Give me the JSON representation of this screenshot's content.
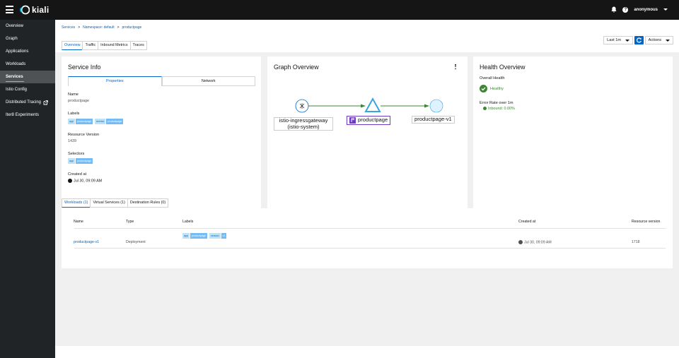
{
  "topbar": {
    "brand": "kiali",
    "user": "anonymous"
  },
  "sidebar": {
    "items": [
      {
        "label": "Overview",
        "active": false
      },
      {
        "label": "Graph",
        "active": false
      },
      {
        "label": "Applications",
        "active": false
      },
      {
        "label": "Workloads",
        "active": false
      },
      {
        "label": "Services",
        "active": true
      },
      {
        "label": "Istio Config",
        "active": false
      },
      {
        "label": "Distributed Tracing",
        "active": false,
        "external": true
      },
      {
        "label": "Iter8 Experiments",
        "active": false
      }
    ]
  },
  "breadcrumb": {
    "items": [
      "Services",
      "Namespace: default",
      "productpage"
    ],
    "separator": ">"
  },
  "tabs": [
    "Overview",
    "Traffic",
    "Inbound Metrics",
    "Traces"
  ],
  "toolbar": {
    "range": "Last 1m",
    "actions": "Actions"
  },
  "service_info": {
    "title": "Service Info",
    "tabs": [
      "Properties",
      "Network"
    ],
    "name_label": "Name",
    "name_value": "productpage",
    "labels_label": "Labels",
    "labels": [
      {
        "key": "app",
        "value": "productpage"
      },
      {
        "key": "service",
        "value": "productpage"
      }
    ],
    "resource_version_label": "Resource Version",
    "resource_version_value": "1439",
    "selectors_label": "Selectors",
    "selectors": [
      {
        "key": "app",
        "value": "productpage"
      }
    ],
    "created_label": "Created at",
    "created_value": "Jul 30, 09:09 AM"
  },
  "graph": {
    "title": "Graph Overview",
    "nodes": [
      "istio-ingressgateway\n(istio-system)",
      "productpage",
      "productpage-v1"
    ],
    "node_lines": {
      "gateway_1": "istio-ingressgateway",
      "gateway_2": "(istio-system)",
      "service": "productpage",
      "version": "productpage-v1"
    }
  },
  "health": {
    "title": "Health Overview",
    "overall_label": "Overall Health",
    "overall_value": "Healthy",
    "error_rate_label": "Error Rate over 1m",
    "inbound_value": "Inbound: 0.00%"
  },
  "bottom_tabs": [
    "Workloads (1)",
    "Virtual Services (1)",
    "Destination Rules (0)"
  ],
  "workloads_table": {
    "columns": [
      "Name",
      "Type",
      "Labels",
      "Created at",
      "Resource version"
    ],
    "rows": [
      {
        "name": "productpage-v1",
        "type": "Deployment",
        "labels": [
          {
            "key": "app",
            "value": "productpage"
          },
          {
            "key": "version",
            "value": "v1"
          }
        ],
        "created": "Jul 30, 09:09 AM",
        "resource_version": "1718"
      }
    ]
  },
  "colors": {
    "accent": "#0066cc",
    "healthy": "#3e8635",
    "edge": "#3e8635",
    "nav_bg": "#212427",
    "top_bg": "#151515",
    "service_node": "#6e3cc2"
  }
}
